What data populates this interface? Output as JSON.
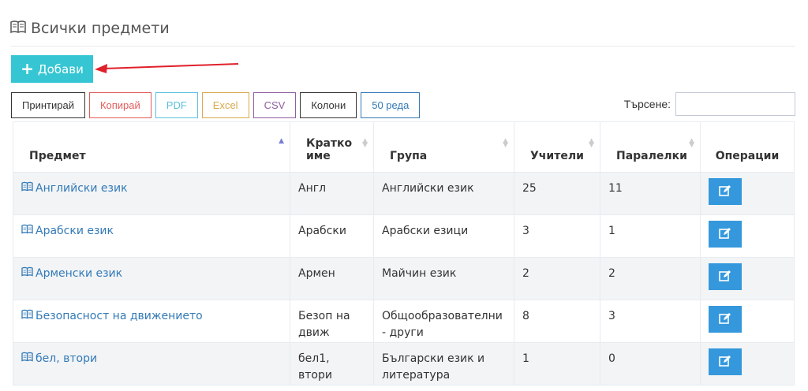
{
  "header": {
    "title_icon": "book-icon",
    "title": "Всички предмети"
  },
  "add_button": {
    "icon": "plus-icon",
    "label": "Добави"
  },
  "toolbar": {
    "buttons": [
      {
        "label": "Принтирай",
        "color": "#333333"
      },
      {
        "label": "Копирай",
        "color": "#e35b5a"
      },
      {
        "label": "PDF",
        "color": "#5bc0de"
      },
      {
        "label": "Excel",
        "color": "#d7a94a"
      },
      {
        "label": "CSV",
        "color": "#8e5fa2"
      },
      {
        "label": "Колони",
        "color": "#333333"
      },
      {
        "label": "50 реда",
        "color": "#337ab7"
      }
    ]
  },
  "search": {
    "label": "Търсене:",
    "value": ""
  },
  "table": {
    "columns": [
      "Предмет",
      "Кратко име",
      "Група",
      "Учители",
      "Паралелки",
      "Операции"
    ],
    "rows": [
      {
        "subject": "Английски език",
        "short": "Англ",
        "group": "Английски език",
        "teachers": "25",
        "classes": "11"
      },
      {
        "subject": "Арабски език",
        "short": "Арабски",
        "group": "Арабски езици",
        "teachers": "3",
        "classes": "1"
      },
      {
        "subject": "Арменски език",
        "short": "Армен",
        "group": "Майчин език",
        "teachers": "2",
        "classes": "2"
      },
      {
        "subject": "Безопасност на движението",
        "short": "Безоп на движ",
        "group": "Общообразователни - други",
        "teachers": "8",
        "classes": "3"
      },
      {
        "subject": "бел, втори",
        "short": "бел1, втори",
        "group": "Български език и литература",
        "teachers": "1",
        "classes": "0"
      }
    ]
  },
  "colors": {
    "accent": "#36c6d3",
    "edit": "#3598dc",
    "link": "#337ab7",
    "annotation_arrow": "#e0202a"
  }
}
